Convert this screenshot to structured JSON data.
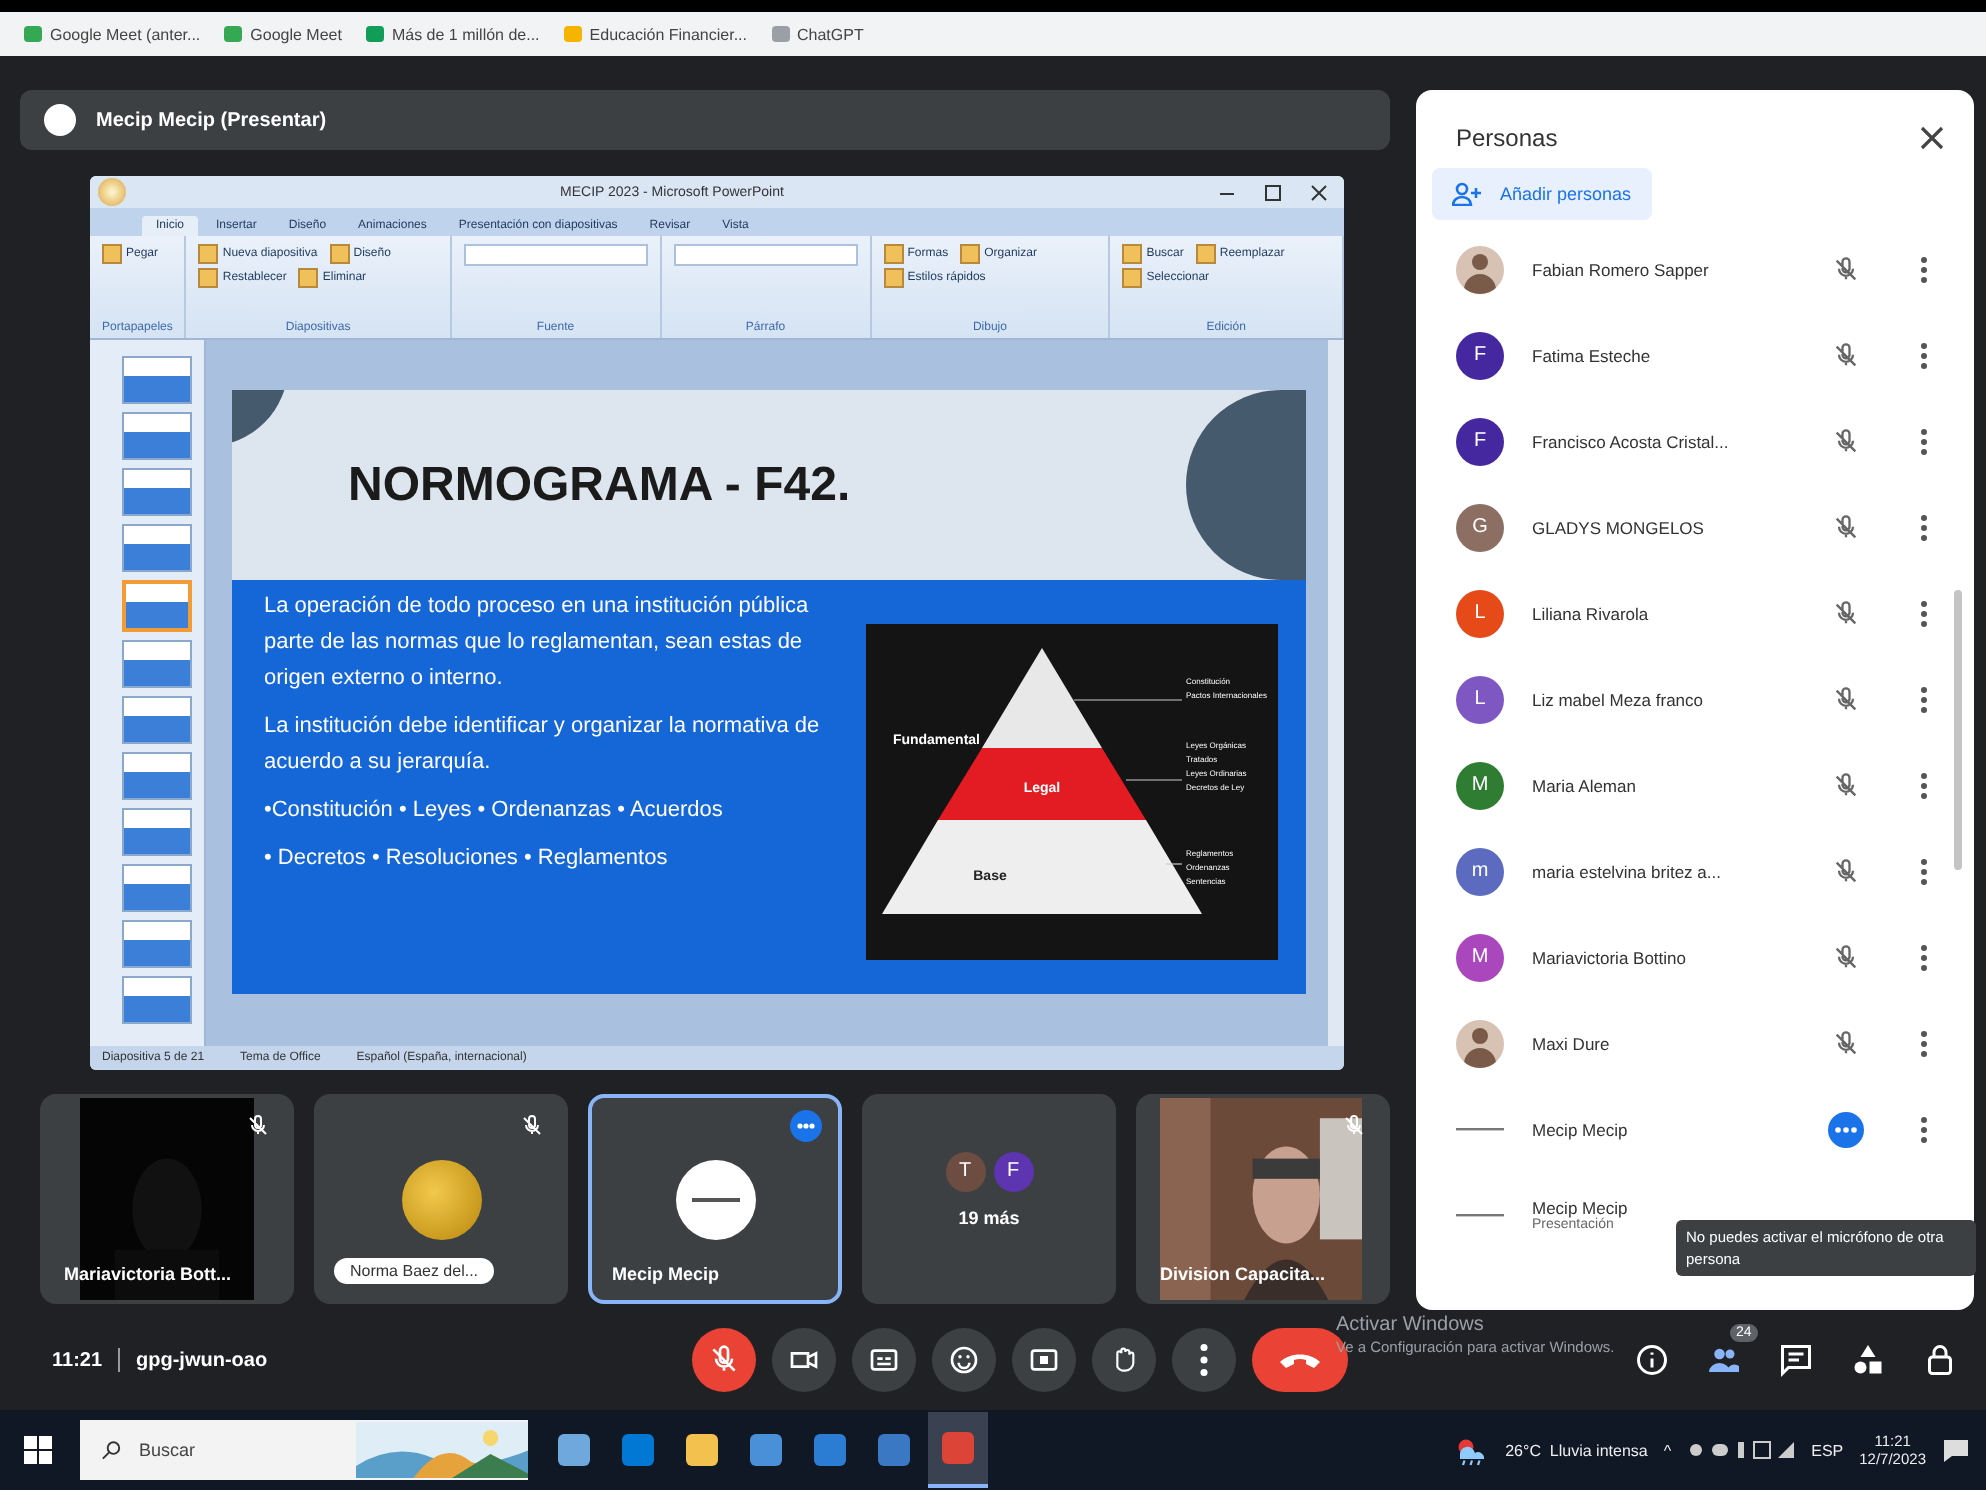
{
  "bookmarks": [
    {
      "label": "Google Meet (anter..."
    },
    {
      "label": "Google Meet"
    },
    {
      "label": "Más de 1 millón de..."
    },
    {
      "label": "Educación Financier..."
    },
    {
      "label": "ChatGPT"
    }
  ],
  "presenter_bar": {
    "title": "Mecip Mecip (Presentar)"
  },
  "powerpoint": {
    "title": "MECIP 2023 - Microsoft PowerPoint",
    "tabs": [
      {
        "label": "Inicio",
        "selected": true
      },
      {
        "label": "Insertar",
        "selected": false
      },
      {
        "label": "Diseño",
        "selected": false
      },
      {
        "label": "Animaciones",
        "selected": false
      },
      {
        "label": "Presentación con diapositivas",
        "selected": false
      },
      {
        "label": "Revisar",
        "selected": false
      },
      {
        "label": "Vista",
        "selected": false
      }
    ],
    "ribbon_groups": [
      {
        "label": "Portapapeles",
        "commands": [
          "Pegar"
        ]
      },
      {
        "label": "Diapositivas",
        "commands": [
          "Nueva diapositiva",
          "Diseño",
          "Restablecer",
          "Eliminar"
        ]
      },
      {
        "label": "Fuente"
      },
      {
        "label": "Párrafo"
      },
      {
        "label": "Dibujo",
        "commands": [
          "Formas",
          "Organizar",
          "Estilos rápidos"
        ]
      },
      {
        "label": "Edición",
        "commands": [
          "Buscar",
          "Reemplazar",
          "Seleccionar"
        ]
      }
    ],
    "thumbnails": [
      {
        "selected": false
      },
      {
        "selected": false
      },
      {
        "selected": false
      },
      {
        "selected": false
      },
      {
        "selected": true
      },
      {
        "selected": false
      },
      {
        "selected": false
      },
      {
        "selected": false
      },
      {
        "selected": false
      },
      {
        "selected": false
      },
      {
        "selected": false
      },
      {
        "selected": false
      }
    ],
    "slide": {
      "title": "NORMOGRAMA - F42.",
      "paragraphs": [
        "La operación de todo proceso en una institución pública parte de las normas que lo reglamentan, sean estas de origen externo o interno.",
        "La institución debe identificar y organizar la normativa de acuerdo a su jerarquía."
      ],
      "bullet_lines": [
        "•Constitución • Leyes • Ordenanzas • Acuerdos",
        "• Decretos • Resoluciones • Reglamentos"
      ],
      "pyramid": {
        "levels": [
          "Fundamental",
          "Legal",
          "Base"
        ],
        "notes": [
          [
            "Constitución",
            "Pactos Internacionales"
          ],
          [
            "Leyes Orgánicas",
            "Tratados",
            "Leyes Ordinarias",
            "Decretos de Ley"
          ],
          [
            "Reglamentos",
            "Ordenanzas",
            "Sentencias"
          ]
        ]
      }
    },
    "status_bar": [
      "Diapositiva 5 de 21",
      "Tema de Office",
      "Español (España, internacional)"
    ]
  },
  "tiles": [
    {
      "kind": "video",
      "name": "Mariavictoria Bott...",
      "muted": true,
      "presenting": false,
      "selected": false
    },
    {
      "kind": "avatar",
      "name": "Norma Baez del...",
      "muted": true,
      "presenting": false,
      "selected": false
    },
    {
      "kind": "logo",
      "name": "Mecip Mecip",
      "muted": false,
      "presenting": true,
      "selected": true
    },
    {
      "kind": "more",
      "name": "19 más",
      "muted": false,
      "presenting": false,
      "selected": false,
      "initials": [
        {
          "letter": "T",
          "color": "#6d4c41"
        },
        {
          "letter": "F",
          "color": "#5e35b1"
        }
      ]
    },
    {
      "kind": "camera",
      "name": "Division Capacita...",
      "muted": true,
      "presenting": false,
      "selected": false
    }
  ],
  "meeting": {
    "time": "11:21",
    "code": "gpg-jwun-oao"
  },
  "controls": [
    {
      "kind": "mic",
      "on": false
    },
    {
      "kind": "camera",
      "on": true
    },
    {
      "kind": "captions"
    },
    {
      "kind": "emoji"
    },
    {
      "kind": "present"
    },
    {
      "kind": "hand"
    },
    {
      "kind": "more"
    },
    {
      "kind": "end"
    }
  ],
  "side_controls": [
    {
      "kind": "info"
    },
    {
      "kind": "people",
      "badge": "24"
    },
    {
      "kind": "chat"
    },
    {
      "kind": "activities"
    },
    {
      "kind": "lock"
    }
  ],
  "people_panel": {
    "title": "Personas",
    "add_button": "Añadir personas",
    "participants": [
      {
        "name": "Fabian Romero Sapper",
        "muted": true,
        "presenting": false,
        "menu": true
      },
      {
        "kind": "letter",
        "initial": "F",
        "color": "#4527a0",
        "name": "Fatima Esteche",
        "muted": true,
        "presenting": false,
        "menu": true
      },
      {
        "kind": "letter",
        "initial": "F",
        "color": "#4527a0",
        "name": "Francisco Acosta Cristal...",
        "muted": true,
        "presenting": false,
        "menu": true
      },
      {
        "kind": "letter",
        "initial": "G",
        "color": "#8d6e63",
        "name": "GLADYS MONGELOS",
        "muted": true,
        "presenting": false,
        "menu": true
      },
      {
        "kind": "letter",
        "initial": "L",
        "color": "#e64a19",
        "name": "Liliana Rivarola",
        "muted": true,
        "presenting": false,
        "menu": true
      },
      {
        "kind": "letter",
        "initial": "L",
        "color": "#7e57c2",
        "name": "Liz mabel Meza franco",
        "muted": true,
        "presenting": false,
        "menu": true
      },
      {
        "kind": "letter",
        "initial": "M",
        "color": "#2e7d32",
        "name": "Maria Aleman",
        "muted": true,
        "presenting": false,
        "menu": true
      },
      {
        "kind": "letter",
        "initial": "m",
        "color": "#5c6bc0",
        "name": "maria estelvina britez a...",
        "muted": true,
        "presenting": false,
        "menu": true
      },
      {
        "kind": "letter",
        "initial": "M",
        "color": "#ab47bc",
        "name": "Mariavictoria Bottino",
        "muted": true,
        "presenting": false,
        "menu": true
      },
      {
        "name": "Maxi Dure",
        "muted": true,
        "presenting": false,
        "menu": true
      },
      {
        "kind": "logo",
        "name": "Mecip Mecip",
        "muted": false,
        "presenting": true,
        "menu": true
      },
      {
        "kind": "logo",
        "name": "Mecip Mecip",
        "subtitle": "Presentación",
        "muted": false,
        "presenting": false,
        "menu": false
      }
    ]
  },
  "tooltip": "No puedes activar el micrófono de otra persona",
  "activation_notice": {
    "title": "Activar Windows",
    "text": "Ve a Configuración para activar Windows."
  },
  "taskbar": {
    "search_placeholder": "Buscar",
    "apps": [
      {
        "selected": false
      },
      {
        "selected": false
      },
      {
        "selected": false
      },
      {
        "selected": false
      },
      {
        "selected": false
      },
      {
        "selected": false
      },
      {
        "selected": true
      }
    ],
    "weather": "26°C  Lluvia intensa",
    "tray_arrow": "^",
    "language": "ESP",
    "time": "11:21",
    "date": "12/7/2023"
  }
}
